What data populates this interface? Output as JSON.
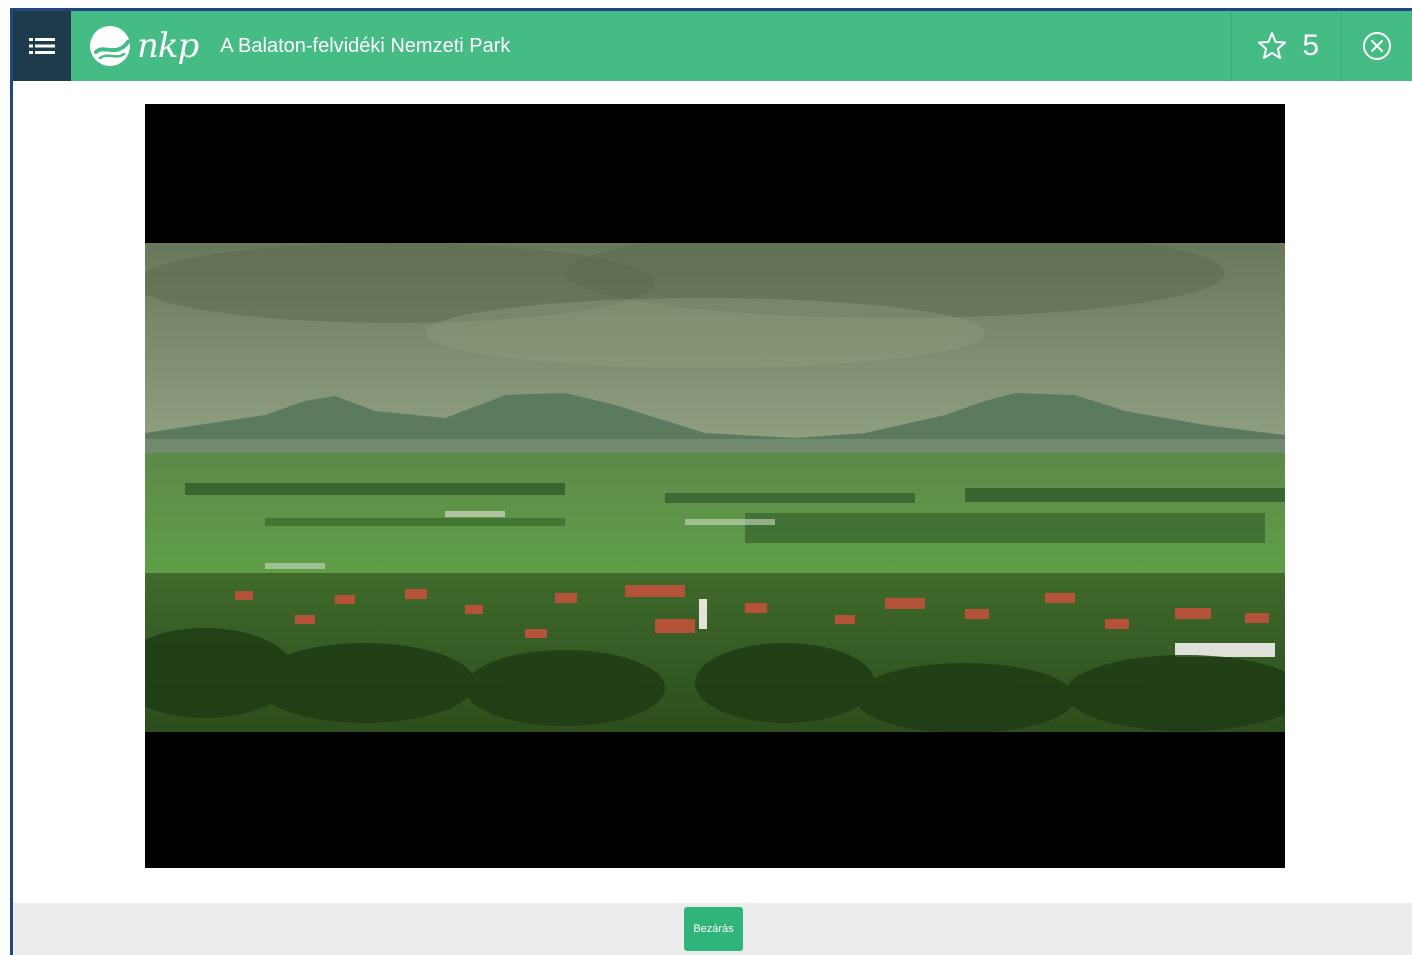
{
  "header": {
    "logo_text": "nkp",
    "title": "A Balaton-felvidéki Nemzeti Park",
    "score": "5",
    "menu_icon": "list-icon",
    "score_icon": "star-outline-icon",
    "close_icon": "circle-close-icon"
  },
  "footer": {
    "close_label": "Bezárás"
  },
  "colors": {
    "topbar": "#45bb86",
    "menu_bg": "#1e3a4d",
    "button": "#2fb47c",
    "footer_bg": "#ececec"
  }
}
